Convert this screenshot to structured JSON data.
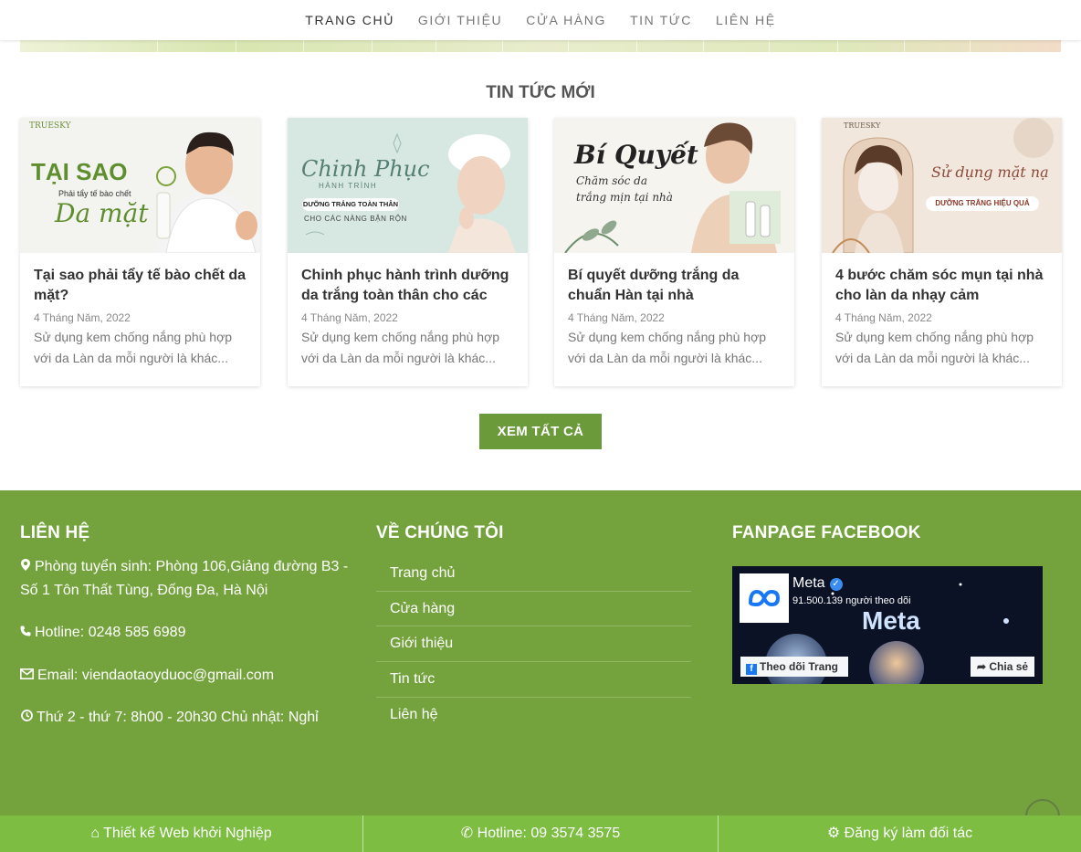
{
  "nav": {
    "items": [
      {
        "label": "TRANG CHỦ"
      },
      {
        "label": "GIỚI THIỆU"
      },
      {
        "label": "CỬA HÀNG"
      },
      {
        "label": "TIN TỨC"
      },
      {
        "label": "LIÊN HỆ"
      }
    ]
  },
  "news": {
    "title": "TIN TỨC MỚI",
    "view_all": "XEM TẤT CẢ",
    "posts": [
      {
        "title": "Tại sao phải tẩy tế bào chết da mặt?",
        "date": "4 Tháng Năm, 2022",
        "excerpt": "Sử dụng kem chống nắng phù hợp với da Làn da mỗi người là khác...",
        "thumb": {
          "brand": "TRUESKY",
          "headline": "TẠI SAO",
          "sub": "Phải tẩy tế bào chết",
          "script": "Da mặt"
        }
      },
      {
        "title": "Chinh phục hành trình dưỡng da trắng toàn thân cho các",
        "date": "4 Tháng Năm, 2022",
        "excerpt": "Sử dụng kem chống nắng phù hợp với da Làn da mỗi người là khác...",
        "thumb": {
          "script": "Chinh Phục",
          "sub": "HÀNH TRÌNH",
          "pill": "DƯỠNG TRẮNG TOÀN THÂN",
          "tag": "CHO CÁC NÀNG BẬN RỘN"
        }
      },
      {
        "title": "Bí quyết dưỡng trắng da chuẩn Hàn tại nhà",
        "date": "4 Tháng Năm, 2022",
        "excerpt": "Sử dụng kem chống nắng phù hợp với da Làn da mỗi người là khác...",
        "thumb": {
          "script": "Bí Quyết",
          "line1": "Chăm sóc da",
          "line2": "trắng mịn tại nhà"
        }
      },
      {
        "title": "4 bước chăm sóc mụn tại nhà cho làn da nhạy cảm",
        "date": "4 Tháng Năm, 2022",
        "excerpt": "Sử dụng kem chống nắng phù hợp với da Làn da mỗi người là khác...",
        "thumb": {
          "brand": "TRUESKY",
          "script": "Sử dụng mặt nạ",
          "pill": "DƯỠNG TRẮNG HIỆU QUẢ"
        }
      }
    ]
  },
  "footer": {
    "contact": {
      "heading": "LIÊN HỆ",
      "address": "Phòng tuyển sinh: Phòng 106,Giảng đường B3 - Số 1 Tôn Thất Tùng, Đống Đa, Hà Nội",
      "hotline": "Hotline: 0248 585 6989",
      "email": "Email: viendaotaoyduoc@gmail.com",
      "hours": "Thứ 2 - thứ 7: 8h00 - 20h30 Chủ nhật: Nghỉ"
    },
    "about": {
      "heading": "VỀ CHÚNG TÔI",
      "links": [
        "Trang chủ",
        "Cửa hàng",
        "Giới thiệu",
        "Tin tức",
        "Liên hệ"
      ]
    },
    "fanpage": {
      "heading": "FANPAGE FACEBOOK",
      "page_name": "Meta",
      "followers": "91.500.139 người theo dõi",
      "cover_word": "Meta",
      "follow_label": "Theo dõi Trang",
      "share_label": "Chia sẻ"
    }
  },
  "bottom_bar": {
    "items": [
      {
        "label": "Thiết kế Web khởi Nghiệp",
        "icon": "home-icon"
      },
      {
        "label": "Hotline: 09 3574 3575",
        "icon": "phone-icon"
      },
      {
        "label": "Đăng ký làm đối tác",
        "icon": "gear-icon"
      }
    ]
  },
  "colors": {
    "accent_green": "#74a33d",
    "button_green": "#6b9a3a",
    "bottom_bar_green": "#7cbd42"
  }
}
